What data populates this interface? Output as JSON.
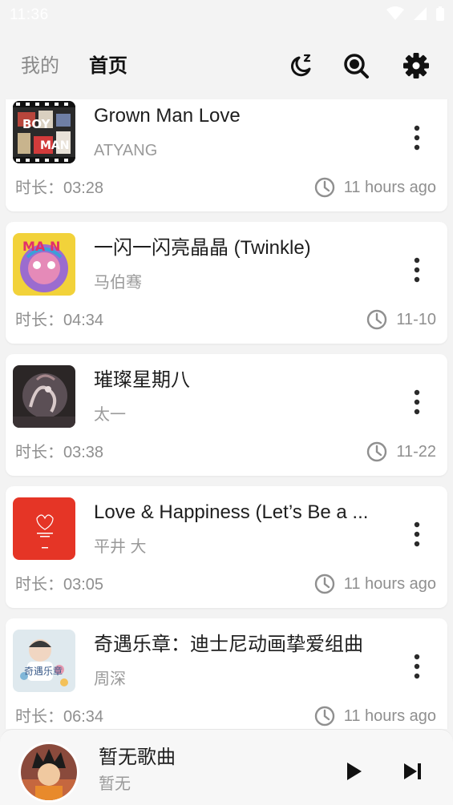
{
  "status_bar": {
    "time": "11:36",
    "icons": [
      "wifi-icon",
      "signal-icon",
      "battery-icon"
    ]
  },
  "header": {
    "tabs": [
      {
        "label": "我的"
      },
      {
        "label": "首页"
      }
    ],
    "active_tab": "首页",
    "actions": [
      "sleep-timer-icon",
      "search-icon",
      "gear-icon"
    ]
  },
  "songs": [
    {
      "title": "Grown Man Love",
      "artist": "ATYANG",
      "duration": "时长：03:28",
      "date": "11 hours ago"
    },
    {
      "title": "一闪一闪亮晶晶 (Twinkle)",
      "artist": "马伯骞",
      "duration": "时长：04:34",
      "date": "11-10"
    },
    {
      "title": "璀璨星期八",
      "artist": "太一",
      "duration": "时长：03:38",
      "date": "11-22"
    },
    {
      "title": "Love & Happiness (Let’s Be a ...",
      "artist": "平井 大",
      "duration": "时长：03:05",
      "date": "11 hours ago"
    },
    {
      "title": "奇遇乐章：迪士尼动画挚爱组曲",
      "artist": "周深",
      "duration": "时长：06:34",
      "date": "11 hours ago"
    }
  ],
  "player": {
    "title": "暂无歌曲",
    "artist": "暂无"
  },
  "colors": {
    "background": "#f3f3f3",
    "card": "#ffffff",
    "text": "#1e1e1e",
    "secondary": "#9a9a9a",
    "accent_cover": "#e53526"
  }
}
